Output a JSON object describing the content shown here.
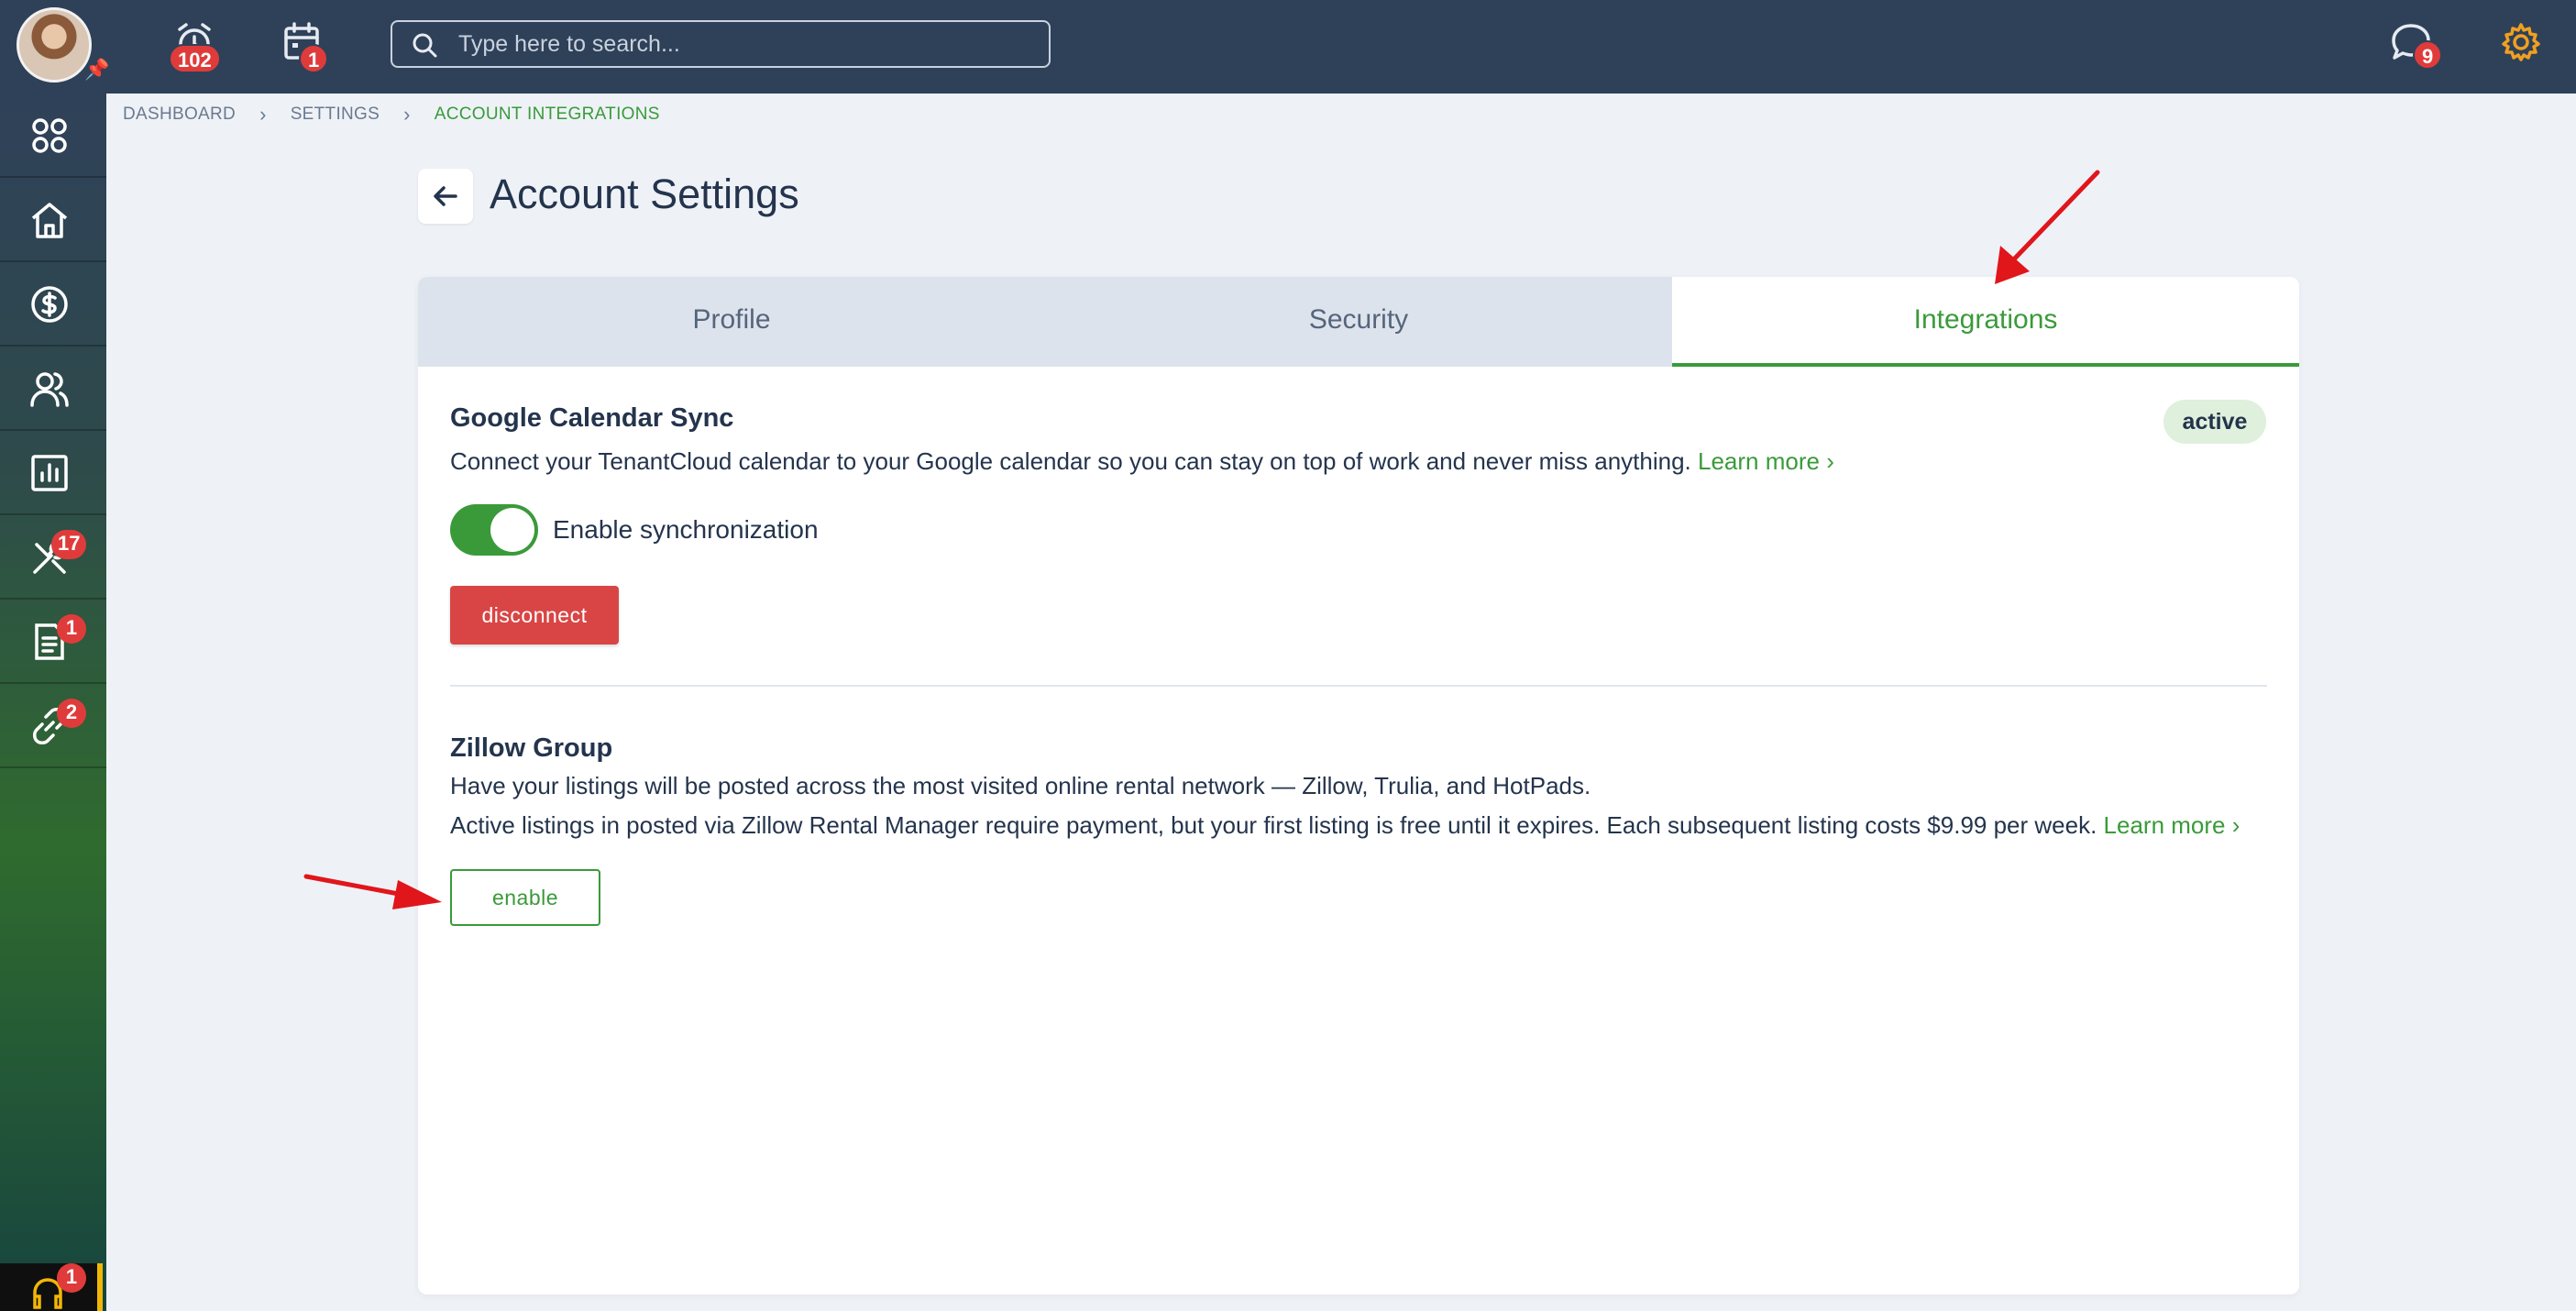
{
  "topbar": {
    "search_placeholder": "Type here to search...",
    "alarm_count": "102",
    "calendar_count": "1",
    "messages_count": "9"
  },
  "sidebar": {
    "items": [
      {
        "name": "apps",
        "badge": ""
      },
      {
        "name": "home",
        "badge": ""
      },
      {
        "name": "money",
        "badge": ""
      },
      {
        "name": "contacts",
        "badge": ""
      },
      {
        "name": "reports",
        "badge": ""
      },
      {
        "name": "maintenance",
        "badge": "17"
      },
      {
        "name": "documents",
        "badge": "1"
      },
      {
        "name": "links",
        "badge": "2"
      }
    ],
    "support_badge": "1"
  },
  "breadcrumb": {
    "items": [
      "DASHBOARD",
      "SETTINGS",
      "ACCOUNT INTEGRATIONS"
    ]
  },
  "page": {
    "title": "Account Settings"
  },
  "tabs": [
    {
      "label": "Profile",
      "active": false
    },
    {
      "label": "Security",
      "active": false
    },
    {
      "label": "Integrations",
      "active": true
    }
  ],
  "google": {
    "title": "Google Calendar Sync",
    "status": "active",
    "description": "Connect your TenantCloud calendar to your Google calendar so you can stay on top of work and never miss anything.",
    "learn_more": "Learn more",
    "toggle_label": "Enable synchronization",
    "toggle_on": true,
    "disconnect_label": "disconnect"
  },
  "zillow": {
    "title": "Zillow Group",
    "line1": "Have your listings will be posted across the most visited online rental network — Zillow, Trulia, and HotPads.",
    "line2": "Active listings in posted via Zillow Rental Manager require payment, but your first listing is free until it expires. Each subsequent listing costs $9.99 per week.",
    "learn_more": "Learn more",
    "enable_label": "enable"
  },
  "colors": {
    "topbar": "#2f4159",
    "accent_green": "#3a9a3a",
    "danger": "#d94545",
    "annotation_arrow": "#e0161b"
  }
}
